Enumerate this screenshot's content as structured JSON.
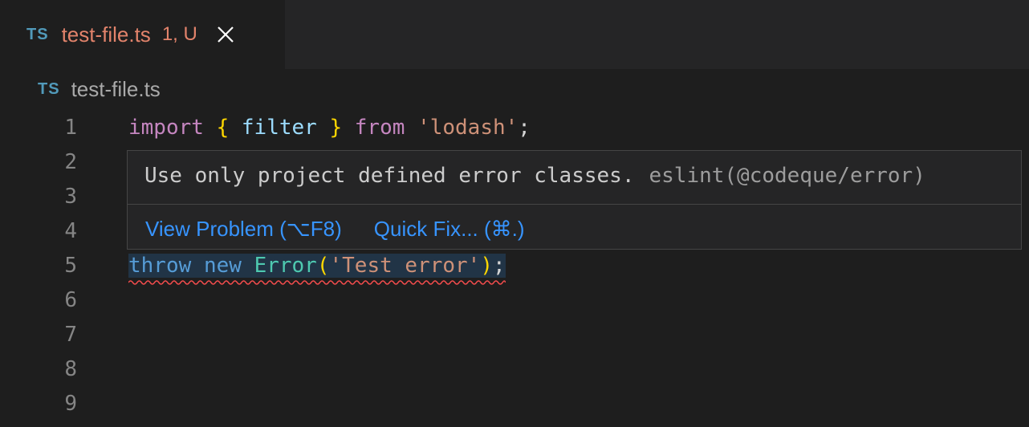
{
  "tab": {
    "icon_text": "TS",
    "filename": "test-file.ts",
    "status": "1, U",
    "close_icon": "close-icon"
  },
  "breadcrumb": {
    "icon_text": "TS",
    "filename": "test-file.ts"
  },
  "editor": {
    "line_numbers": [
      "1",
      "2",
      "3",
      "4",
      "5",
      "6",
      "7",
      "8",
      "9"
    ],
    "line1": {
      "import": "import",
      "open_brace": "{",
      "ident": "filter",
      "close_brace": "}",
      "from": "from",
      "module": "'lodash'",
      "semi": ";"
    },
    "line5": {
      "throw": "throw",
      "new": "new",
      "cls": "Error",
      "open_paren": "(",
      "msg": "'Test error'",
      "close_paren": ")",
      "semi": ";"
    }
  },
  "hover": {
    "message": "Use only project defined error classes.",
    "source": "eslint(@codeque/error)",
    "view_problem": "View Problem (⌥F8)",
    "quick_fix": "Quick Fix... (⌘.)"
  },
  "colors": {
    "editor_bg": "#1e1e1e",
    "tab_inactive_bg": "#252526",
    "modified_tab_text": "#e2836b",
    "link": "#3794ff",
    "error_squiggle": "#f14c4c"
  }
}
